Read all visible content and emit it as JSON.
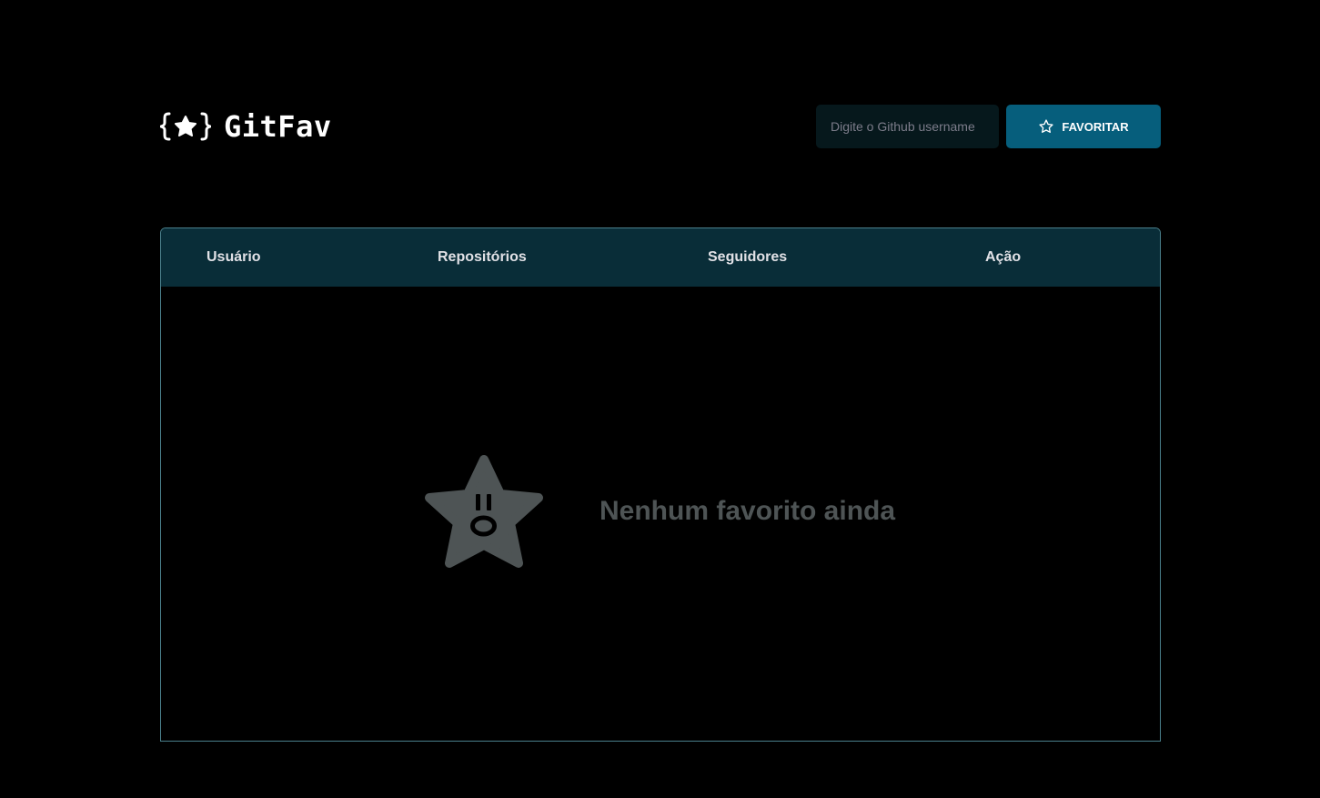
{
  "app": {
    "title": "GitFav",
    "logo_icon": "braces-star-icon"
  },
  "search": {
    "placeholder": "Digite o Github username",
    "value": "",
    "button_label": "FAVORITAR",
    "button_icon": "star-outline-icon"
  },
  "table": {
    "columns": [
      "Usuário",
      "Repositórios",
      "Seguidores",
      "Ação"
    ],
    "rows": []
  },
  "empty_state": {
    "message": "Nenhum favorito ainda",
    "icon": "surprised-star-icon"
  },
  "colors": {
    "background": "#000000",
    "header_row": "#092D38",
    "accent_button": "#065E7C",
    "input_bg": "#06181C",
    "border": "#4A808C",
    "empty_text": "#4E5455"
  }
}
